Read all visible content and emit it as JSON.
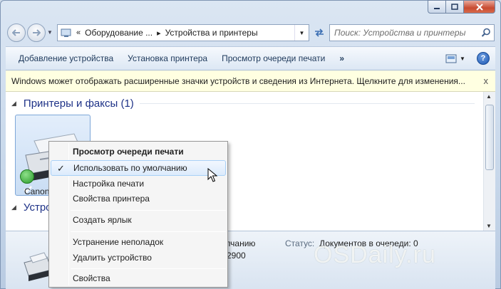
{
  "address": {
    "segments": [
      "Оборудование ...",
      "Устройства и принтеры"
    ],
    "chevron": "«"
  },
  "search": {
    "placeholder": "Поиск: Устройства и принтеры"
  },
  "toolbar": {
    "items": [
      "Добавление устройства",
      "Установка принтера",
      "Просмотр очереди печати"
    ],
    "more": "»",
    "help": "?"
  },
  "infobar": {
    "text": "Windows может отображать расширенные значки устройств и сведения из Интернета.  Щелкните для изменения...",
    "close": "x"
  },
  "content": {
    "group1": "Принтеры и факсы (1)",
    "group2": "Устро",
    "printer_name": "Canon"
  },
  "details": {
    "line1": "олчанию",
    "line2": "P2900",
    "status_label": "Статус:",
    "status_value": "Документов в очереди: 0",
    "watermark": "OSDaily.ru"
  },
  "menu": {
    "items": [
      {
        "label": "Просмотр очереди печати",
        "bold": true
      },
      {
        "label": "Использовать по умолчанию",
        "checked": true
      },
      {
        "label": "Настройка печати"
      },
      {
        "label": "Свойства принтера"
      },
      {
        "label": "Создать ярлык"
      },
      {
        "label": "Устранение неполадок"
      },
      {
        "label": "Удалить устройство"
      },
      {
        "label": "Свойства"
      }
    ],
    "check_glyph": "✓"
  },
  "icons": {
    "printer": "printer-icon",
    "default_check": "green-check-icon",
    "search": "search-icon",
    "help": "help-icon"
  }
}
